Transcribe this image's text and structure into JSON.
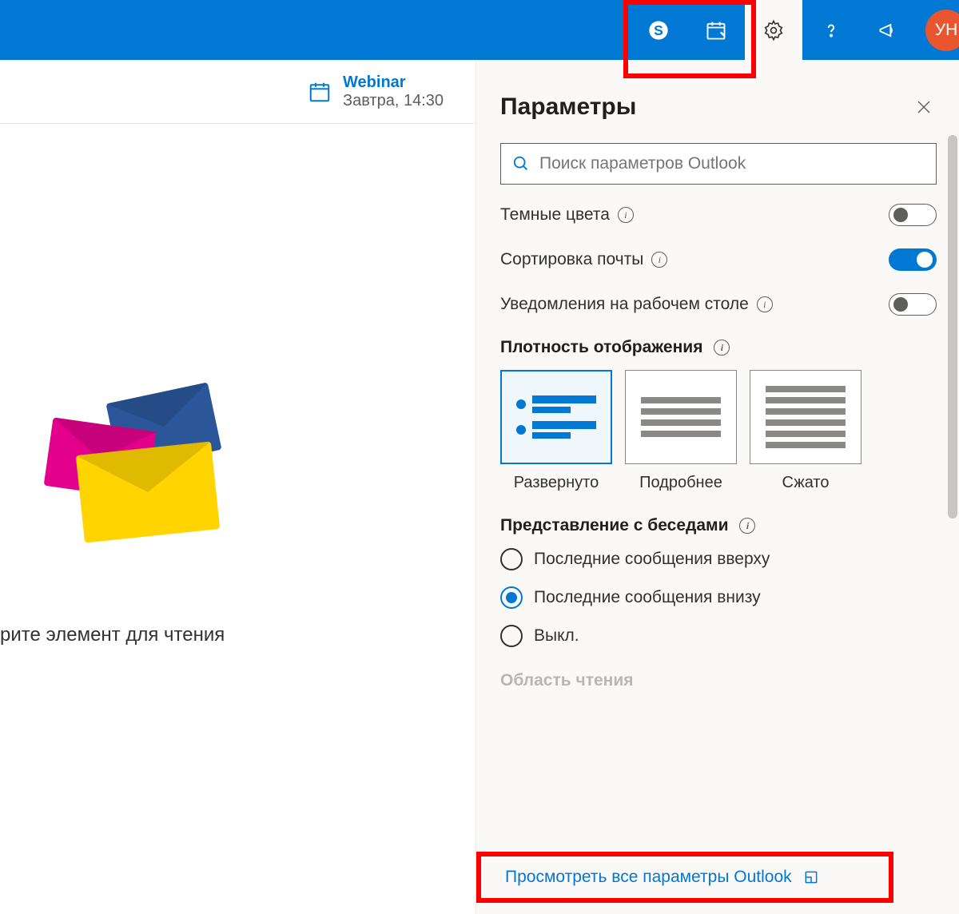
{
  "header": {
    "avatar_initials": "УН"
  },
  "reminder": {
    "title": "Webinar",
    "subtitle": "Завтра, 14:30"
  },
  "empty_state": {
    "text": "рите элемент для чтения"
  },
  "panel": {
    "title": "Параметры",
    "search_placeholder": "Поиск параметров Outlook",
    "settings": {
      "dark_mode_label": "Темные цвета",
      "focused_inbox_label": "Сортировка почты",
      "desktop_notifications_label": "Уведомления на рабочем столе"
    },
    "density": {
      "section": "Плотность отображения",
      "options": [
        "Развернуто",
        "Подробнее",
        "Сжато"
      ],
      "selected_index": 0
    },
    "conversation_view": {
      "section": "Представление с беседами",
      "options": [
        "Последние сообщения вверху",
        "Последние сообщения внизу",
        "Выкл."
      ],
      "selected_index": 1
    },
    "reading_pane_section": "Область чтения",
    "view_all": "Просмотреть все параметры Outlook"
  }
}
